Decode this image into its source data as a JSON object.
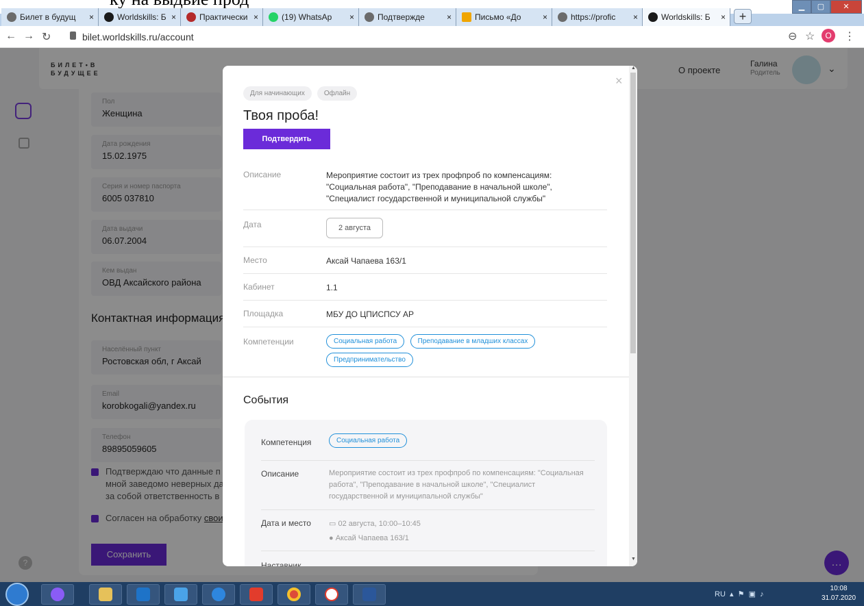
{
  "doc_fragment": "ку на  выдвие прод",
  "browser": {
    "tabs": [
      {
        "label": "Билет в будущ",
        "icon_color": "#6b6b6b",
        "active": false
      },
      {
        "label": "Worldskills: Б",
        "icon_color": "#1a1a1a",
        "active": false
      },
      {
        "label": "Практически",
        "icon_color": "#b42a2a",
        "active": false
      },
      {
        "label": "(19) WhatsAp",
        "icon_color": "#25d366",
        "active": false
      },
      {
        "label": "Подтвержде",
        "icon_color": "#6b6b6b",
        "active": false
      },
      {
        "label": "Письмо «До",
        "icon_color": "#f0a500",
        "active": false
      },
      {
        "label": "https://profic",
        "icon_color": "#6b6b6b",
        "active": false
      },
      {
        "label": "Worldskills: Б",
        "icon_color": "#1a1a1a",
        "active": true
      }
    ],
    "new_tab": "+",
    "close_glyph": "×",
    "url": "bilet.worldskills.ru/account",
    "profile_initial": "O"
  },
  "site": {
    "logo_line1": "БИЛЕТ•В",
    "logo_line2": "БУДУЩЕЕ",
    "header_project": "О проекте",
    "user_name": "Галина",
    "user_role": "Родитель"
  },
  "profile": {
    "fields": [
      {
        "label": "Пол",
        "value": "Женщина"
      },
      {
        "label": "Дата рождения",
        "value": "15.02.1975"
      },
      {
        "label": "Серия и номер паспорта",
        "value": "6005 037810"
      },
      {
        "label": "Дата выдачи",
        "value": "06.07.2004"
      },
      {
        "label": "Кем выдан",
        "value": "ОВД Аксайского района"
      }
    ],
    "contact_heading": "Контактная информация",
    "contact_fields": [
      {
        "label": "Населённый пункт",
        "value": "Ростовская обл, г Аксай"
      },
      {
        "label": "Email",
        "value": "korobkogali@yandex.ru"
      },
      {
        "label": "Телефон",
        "value": "89895059605"
      }
    ],
    "consent1_line1": "Подтверждаю что данные п",
    "consent1_line2": "мной заведомо неверных да",
    "consent1_line3": "за собой ответственность в",
    "consent2_text": "Согласен на обработку",
    "consent2_link": "свои",
    "save_label": "Сохранить"
  },
  "modal": {
    "tags": [
      "Для начинающих",
      "Офлайн"
    ],
    "title": "Твоя проба!",
    "confirm_label": "Подтвердить",
    "close_glyph": "×",
    "rows": {
      "description_label": "Описание",
      "description_value": "Мероприятие состоит из трех профпроб по компенсациям: \"Социальная работа\", \"Преподавание в начальной школе\", \"Специалист государственной и муниципальной службы\"",
      "date_label": "Дата",
      "date_value": "2 августа",
      "place_label": "Место",
      "place_value": "Аксай Чапаева 163/1",
      "room_label": "Кабинет",
      "room_value": "1.1",
      "venue_label": "Площадка",
      "venue_value": "МБУ ДО ЦПИСПСУ АР",
      "competencies_label": "Компетенции",
      "competencies": [
        "Социальная работа",
        "Преподавание в младших классах",
        "Предпринимательство"
      ]
    },
    "events_heading": "События",
    "event": {
      "competency_label": "Компетенция",
      "competency_value": "Социальная работа",
      "description_label": "Описание",
      "description_value": "Мероприятие состоит из трех профпроб по компенсациям: \"Социальная работа\", \"Преподавание в начальной школе\", \"Специалист государственной и муниципальной службы\"",
      "datetime_label": "Дата и место",
      "datetime_value": "02 августа, 10:00–10:45",
      "location_value": "Аксай Чапаева 163/1",
      "mentor_label": "Наставник"
    }
  },
  "taskbar": {
    "lang": "RU",
    "time": "10:08",
    "date": "31.07.2020"
  },
  "colors": {
    "accent": "#6b2bd9",
    "chip_blue": "#1f8fd9"
  }
}
